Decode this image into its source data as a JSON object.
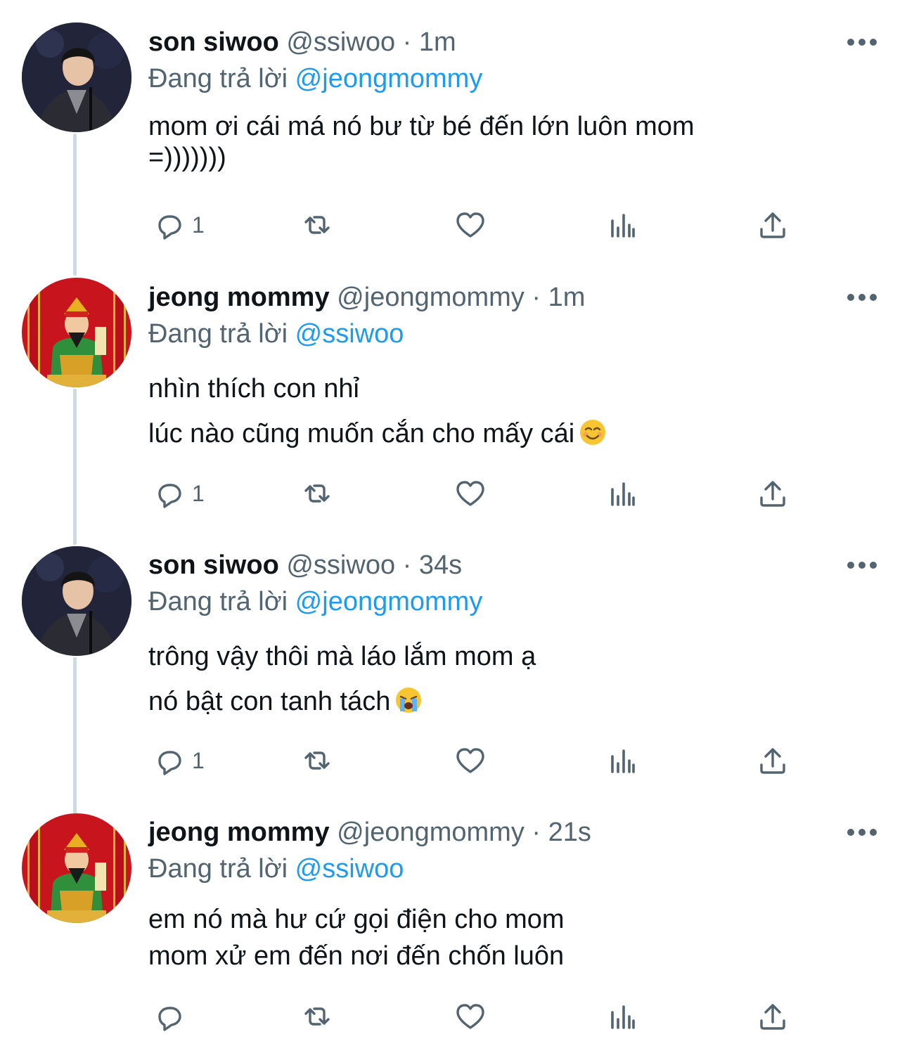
{
  "tweets": [
    {
      "name": "son siwoo",
      "handle": "@ssiwoo",
      "separator": "·",
      "time": "1m",
      "replying_prefix": "Đang trả lời",
      "replying_to": "@jeongmommy",
      "lines": [
        "mom ơi cái má nó bư từ bé đến lớn luôn mom",
        "=)))))))"
      ],
      "reply_count": "1",
      "avatar": "man-in-suit"
    },
    {
      "name": "jeong mommy",
      "handle": "@jeongmommy",
      "separator": "·",
      "time": "1m",
      "replying_prefix": "Đang trả lời",
      "replying_to": "@ssiwoo",
      "lines": [
        "nhìn thích con nhỉ",
        "lúc nào cũng muốn cắn cho mấy cái"
      ],
      "emoji": "smiling-face-emoji",
      "reply_count": "1",
      "avatar": "god-of-wealth"
    },
    {
      "name": "son siwoo",
      "handle": "@ssiwoo",
      "separator": "·",
      "time": "34s",
      "replying_prefix": "Đang trả lời",
      "replying_to": "@jeongmommy",
      "lines": [
        "trông vậy thôi mà láo lắm mom ạ",
        "nó bật con tanh tách"
      ],
      "emoji": "crying-face-emoji",
      "reply_count": "1",
      "avatar": "man-in-suit"
    },
    {
      "name": "jeong mommy",
      "handle": "@jeongmommy",
      "separator": "·",
      "time": "21s",
      "replying_prefix": "Đang trả lời",
      "replying_to": "@ssiwoo",
      "lines": [
        "em nó mà hư cứ gọi điện cho mom",
        "mom xử em đến nơi đến chốn luôn"
      ],
      "reply_count": "",
      "avatar": "god-of-wealth"
    }
  ],
  "icons": {
    "reply": "reply-icon",
    "retweet": "retweet-icon",
    "like": "like-icon",
    "views": "analytics-icon",
    "share": "share-icon",
    "more": "more-icon"
  },
  "colors": {
    "accent": "#1d9bf0",
    "secondary_text": "#536471",
    "primary_text": "#0f1419",
    "thread_line": "#cfd9de"
  }
}
